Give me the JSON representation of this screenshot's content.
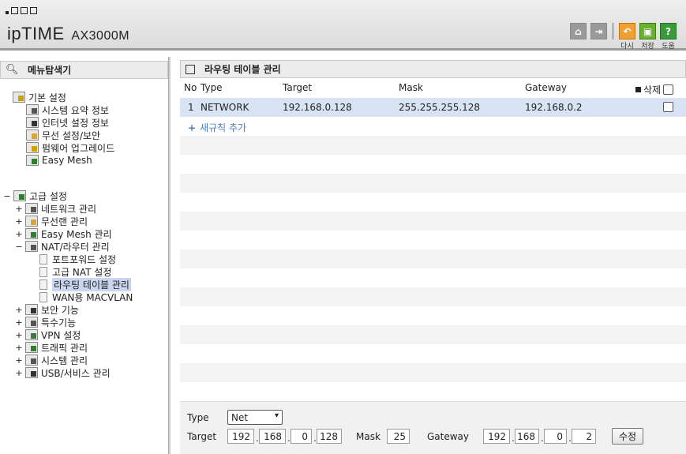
{
  "header": {
    "brand": "ipTIME",
    "model": "AX3000M",
    "icons": [
      {
        "name": "home-icon",
        "caption": ""
      },
      {
        "name": "logout-icon",
        "caption": ""
      },
      {
        "name": "reload-icon",
        "caption": "다시"
      },
      {
        "name": "save-icon",
        "caption": "저장"
      },
      {
        "name": "help-icon",
        "caption": "도움"
      }
    ]
  },
  "left": {
    "title": "메뉴탐색기",
    "basic": {
      "label": "기본 설정",
      "items": [
        "시스템 요약 정보",
        "인터넷 설정 정보",
        "무선 설정/보안",
        "펌웨어 업그레이드",
        "Easy Mesh"
      ]
    },
    "advanced": {
      "label": "고급 설정",
      "items": [
        "네트워크 관리",
        "무선랜 관리",
        "Easy Mesh 관리",
        "NAT/라우터 관리"
      ],
      "nat_children": [
        "포트포워드 설정",
        "고급 NAT 설정",
        "라우팅 테이블 관리",
        "WAN용 MACVLAN"
      ],
      "more_items": [
        "보안 기능",
        "특수기능",
        "VPN 설정",
        "트래픽 관리",
        "시스템 관리",
        "USB/서비스 관리"
      ]
    }
  },
  "right": {
    "title": "라우팅 테이블 관리",
    "columns": {
      "no": "No",
      "type": "Type",
      "target": "Target",
      "mask": "Mask",
      "gateway": "Gateway",
      "delete": "삭제"
    },
    "rows": [
      {
        "no": "1",
        "type": "NETWORK",
        "target": "192.168.0.128",
        "mask": "255.255.255.128",
        "gateway": "192.168.0.2"
      }
    ],
    "add_rule": "새규칙 추가",
    "form": {
      "type_label": "Type",
      "type_value": "Net",
      "target_label": "Target",
      "target": [
        "192",
        "168",
        "0",
        "128"
      ],
      "mask_label": "Mask",
      "mask": "25",
      "gateway_label": "Gateway",
      "gateway": [
        "192",
        "168",
        "0",
        "2"
      ],
      "submit": "수정"
    }
  }
}
